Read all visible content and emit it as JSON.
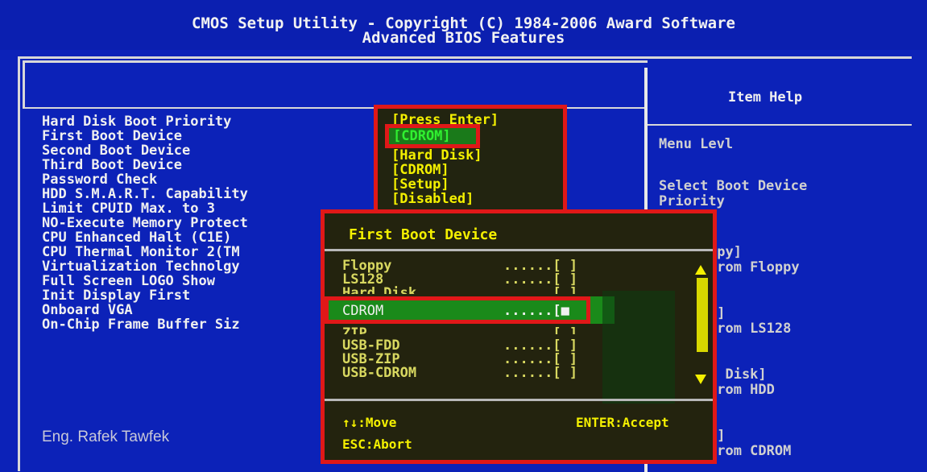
{
  "header": {
    "title_line1": "CMOS Setup Utility - Copyright  (C)  1984-2006 Award Software",
    "title_line2": "Advanced BIOS Features"
  },
  "settings": [
    {
      "label": "Hard Disk Boot Priority",
      "value": "[Press Enter]"
    },
    {
      "label": "First Boot Device",
      "value": "[CDROM]"
    },
    {
      "label": "Second Boot Device",
      "value": "[Hard Disk]"
    },
    {
      "label": "Third Boot Device",
      "value": "[CDROM]"
    },
    {
      "label": "Password Check",
      "value": "[Setup]"
    },
    {
      "label": "HDD S.M.A.R.T. Capability",
      "value": "[Disabled]"
    },
    {
      "label": "Limit CPUID Max. to 3",
      "value": ""
    },
    {
      "label": "NO-Execute Memory Protect",
      "value": ""
    },
    {
      "label": "CPU Enhanced Halt (C1E)",
      "value": ""
    },
    {
      "label": "CPU Thermal Monitor 2(TM",
      "value": ""
    },
    {
      "label": "Virtualization Technolgy",
      "value": ""
    },
    {
      "label": "Full Screen LOGO Show",
      "value": ""
    },
    {
      "label": "Init Display First",
      "value": ""
    },
    {
      "label": "Onboard VGA",
      "value": ""
    },
    {
      "label": "On-Chip Frame Buffer Siz",
      "value": ""
    }
  ],
  "help": {
    "title": "Item Help",
    "menu_level": "Menu Levl",
    "select_line1": "Select Boot Device",
    "select_line2": "Priority",
    "entries": [
      {
        "line1": "ppy]",
        "line2": "from Floppy"
      },
      {
        "line1": "8]",
        "line2": "from LS128"
      },
      {
        "line1": ". Disk]",
        "line2": "from HDD"
      },
      {
        "line1": "M]",
        "line2": "from CDROM"
      }
    ]
  },
  "popup": {
    "title": "First Boot Device",
    "options": [
      {
        "label": "Floppy",
        "dots": "......[ ]"
      },
      {
        "label": "LS128",
        "dots": "......[ ]"
      },
      {
        "label": "Hard Disk",
        "dots": "......[ ]"
      },
      {
        "label": "CDROM",
        "dots": "......[■"
      },
      {
        "label": "ZIP",
        "dots": "......[ ]"
      },
      {
        "label": "USB-FDD",
        "dots": "......[ ]"
      },
      {
        "label": "USB-ZIP",
        "dots": "......[ ]"
      },
      {
        "label": "USB-CDROM",
        "dots": "......[ ]"
      }
    ],
    "footer_move": "↑↓:Move",
    "footer_accept": "ENTER:Accept",
    "footer_abort": "ESC:Abort"
  },
  "watermark": "Eng. Rafek Tawfek",
  "colors": {
    "background": "#0c22b8",
    "highlight": "#e01818",
    "value_yellow": "#f4f000",
    "selected_green": "#1a8a1a"
  }
}
